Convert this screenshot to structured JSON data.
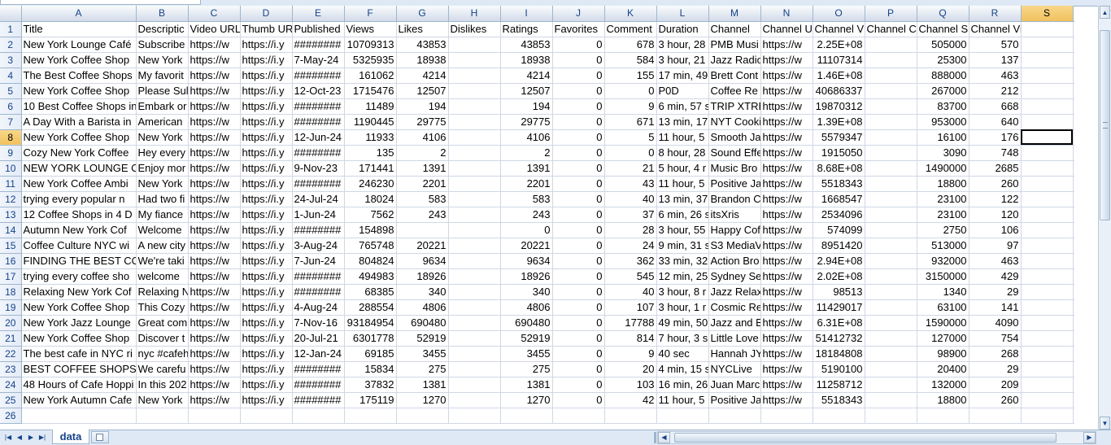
{
  "columns": [
    "A",
    "B",
    "C",
    "D",
    "E",
    "F",
    "G",
    "H",
    "I",
    "J",
    "K",
    "L",
    "M",
    "N",
    "O",
    "P",
    "Q",
    "R",
    "S"
  ],
  "active_cell": {
    "row": 8,
    "col": "S"
  },
  "rows": [
    {
      "num": "1",
      "cells": [
        "Title",
        "Descriptic",
        "Video URL",
        "Thumb UR",
        "Published",
        "Views",
        "Likes",
        "Dislikes",
        "Ratings",
        "Favorites",
        "Comment",
        "Duration",
        "Channel",
        "Channel U",
        "Channel V",
        "Channel C",
        "Channel S",
        "Channel Videos",
        ""
      ]
    },
    {
      "num": "2",
      "cells": [
        "New York Lounge Café",
        "Subscribe",
        "https://w",
        "https://i.y",
        "########",
        "10709313",
        "43853",
        "",
        "43853",
        "0",
        "678",
        "3 hour, 28",
        "PMB Musi",
        "https://w",
        "2.25E+08",
        "",
        "505000",
        "570",
        ""
      ]
    },
    {
      "num": "3",
      "cells": [
        "New York Coffee Shop",
        "New York",
        "https://w",
        "https://i.y",
        "7-May-24",
        "5325935",
        "18938",
        "",
        "18938",
        "0",
        "584",
        "3 hour, 21",
        "Jazz Radio",
        "https://w",
        "11107314",
        "",
        "25300",
        "137",
        ""
      ]
    },
    {
      "num": "4",
      "cells": [
        "The Best Coffee Shops",
        "My favorit",
        "https://w",
        "https://i.y",
        "########",
        "161062",
        "4214",
        "",
        "4214",
        "0",
        "155",
        "17 min, 49",
        "Brett Cont",
        "https://w",
        "1.46E+08",
        "",
        "888000",
        "463",
        ""
      ]
    },
    {
      "num": "5",
      "cells": [
        "New York Coffee Shop",
        "Please Sul",
        "https://w",
        "https://i.y",
        "12-Oct-23",
        "1715476",
        "12507",
        "",
        "12507",
        "0",
        "0",
        "P0D",
        "Coffee Re",
        "https://w",
        "40686337",
        "",
        "267000",
        "212",
        ""
      ]
    },
    {
      "num": "6",
      "cells": [
        "10 Best Coffee Shops in",
        "Embark or",
        "https://w",
        "https://i.y",
        "########",
        "11489",
        "194",
        "",
        "194",
        "0",
        "9",
        "6 min, 57 s",
        "TRIP XTRE",
        "https://w",
        "19870312",
        "",
        "83700",
        "668",
        ""
      ]
    },
    {
      "num": "7",
      "cells": [
        "A Day With a Barista in",
        "American",
        "https://w",
        "https://i.y",
        "########",
        "1190445",
        "29775",
        "",
        "29775",
        "0",
        "671",
        "13 min, 17",
        "NYT Cooki",
        "https://w",
        "1.39E+08",
        "",
        "953000",
        "640",
        ""
      ]
    },
    {
      "num": "8",
      "cells": [
        "New York Coffee Shop",
        "New York",
        "https://w",
        "https://i.y",
        "12-Jun-24",
        "11933",
        "4106",
        "",
        "4106",
        "0",
        "5",
        "11 hour, 5",
        "Smooth Ja",
        "https://w",
        "5579347",
        "",
        "16100",
        "176",
        ""
      ]
    },
    {
      "num": "9",
      "cells": [
        "Cozy New York Coffee",
        "Hey every",
        "https://w",
        "https://i.y",
        "########",
        "135",
        "2",
        "",
        "2",
        "0",
        "0",
        "8 hour, 28",
        "Sound Effe",
        "https://w",
        "1915050",
        "",
        "3090",
        "748",
        ""
      ]
    },
    {
      "num": "10",
      "cells": [
        "NEW YORK LOUNGE CA",
        "Enjoy mor",
        "https://w",
        "https://i.y",
        "9-Nov-23",
        "171441",
        "1391",
        "",
        "1391",
        "0",
        "21",
        "5 hour, 4 r",
        "Music Bro",
        "https://w",
        "8.68E+08",
        "",
        "1490000",
        "2685",
        ""
      ]
    },
    {
      "num": "11",
      "cells": [
        "New York Coffee Ambi",
        "New York",
        "https://w",
        "https://i.y",
        "########",
        "246230",
        "2201",
        "",
        "2201",
        "0",
        "43",
        "11 hour, 5",
        "Positive Ja",
        "https://w",
        "5518343",
        "",
        "18800",
        "260",
        ""
      ]
    },
    {
      "num": "12",
      "cells": [
        "trying every popular n",
        "Had two fi",
        "https://w",
        "https://i.y",
        "24-Jul-24",
        "18024",
        "583",
        "",
        "583",
        "0",
        "40",
        "13 min, 37",
        "Brandon C",
        "https://w",
        "1668547",
        "",
        "23100",
        "122",
        ""
      ]
    },
    {
      "num": "13",
      "cells": [
        "12 Coffee Shops in 4 D",
        "My fiance",
        "https://w",
        "https://i.y",
        "1-Jun-24",
        "7562",
        "243",
        "",
        "243",
        "0",
        "37",
        "6 min, 26 s",
        "itsXris",
        "https://w",
        "2534096",
        "",
        "23100",
        "120",
        ""
      ]
    },
    {
      "num": "14",
      "cells": [
        "Autumn New York Cof",
        "Welcome",
        "https://w",
        "https://i.y",
        "########",
        "154898",
        "",
        "",
        "0",
        "0",
        "28",
        "3 hour, 55",
        "Happy Cof",
        "https://w",
        "574099",
        "",
        "2750",
        "106",
        ""
      ]
    },
    {
      "num": "15",
      "cells": [
        "Coffee Culture NYC wi",
        "A new city",
        "https://w",
        "https://i.y",
        "3-Aug-24",
        "765748",
        "20221",
        "",
        "20221",
        "0",
        "24",
        "9 min, 31 s",
        "S3 MediaV",
        "https://w",
        "8951420",
        "",
        "513000",
        "97",
        ""
      ]
    },
    {
      "num": "16",
      "cells": [
        "FINDING THE BEST COF",
        "We're taki",
        "https://w",
        "https://i.y",
        "7-Jun-24",
        "804824",
        "9634",
        "",
        "9634",
        "0",
        "362",
        "33 min, 32",
        "Action Bro",
        "https://w",
        "2.94E+08",
        "",
        "932000",
        "463",
        ""
      ]
    },
    {
      "num": "17",
      "cells": [
        "trying every coffee sho",
        "welcome",
        "https://w",
        "https://i.y",
        "########",
        "494983",
        "18926",
        "",
        "18926",
        "0",
        "545",
        "12 min, 25",
        "Sydney Se",
        "https://w",
        "2.02E+08",
        "",
        "3150000",
        "429",
        ""
      ]
    },
    {
      "num": "18",
      "cells": [
        "Relaxing New York Cof",
        "Relaxing N",
        "https://w",
        "https://i.y",
        "########",
        "68385",
        "340",
        "",
        "340",
        "0",
        "40",
        "3 hour, 8 r",
        "Jazz Relax",
        "https://w",
        "98513",
        "",
        "1340",
        "29",
        ""
      ]
    },
    {
      "num": "19",
      "cells": [
        "New York Coffee Shop",
        "This Cozy",
        "https://w",
        "https://i.y",
        "4-Aug-24",
        "288554",
        "4806",
        "",
        "4806",
        "0",
        "107",
        "3 hour, 1 r",
        "Cosmic Re",
        "https://w",
        "11429017",
        "",
        "63100",
        "141",
        ""
      ]
    },
    {
      "num": "20",
      "cells": [
        "New York Jazz Lounge",
        "Great com",
        "https://w",
        "https://i.y",
        "7-Nov-16",
        "93184954",
        "690480",
        "",
        "690480",
        "0",
        "17788",
        "49 min, 50",
        "Jazz and B",
        "https://w",
        "6.31E+08",
        "",
        "1590000",
        "4090",
        ""
      ]
    },
    {
      "num": "21",
      "cells": [
        "New York Coffee Shop",
        "Discover t",
        "https://w",
        "https://i.y",
        "20-Jul-21",
        "6301778",
        "52919",
        "",
        "52919",
        "0",
        "814",
        "7 hour, 3 s",
        "Little Love",
        "https://w",
        "51412732",
        "",
        "127000",
        "754",
        ""
      ]
    },
    {
      "num": "22",
      "cells": [
        "The best cafe in NYC ri",
        "nyc #cafeh",
        "https://w",
        "https://i.y",
        "12-Jan-24",
        "69185",
        "3455",
        "",
        "3455",
        "0",
        "9",
        "40 sec",
        "Hannah JY",
        "https://w",
        "18184808",
        "",
        "98900",
        "268",
        ""
      ]
    },
    {
      "num": "23",
      "cells": [
        "BEST COFFEE SHOPS in",
        "We carefu",
        "https://w",
        "https://i.y",
        "########",
        "15834",
        "275",
        "",
        "275",
        "0",
        "20",
        "4 min, 15 s",
        "NYCLive",
        "https://w",
        "5190100",
        "",
        "20400",
        "29",
        ""
      ]
    },
    {
      "num": "24",
      "cells": [
        "48 Hours of Cafe Hoppi",
        "In this 202",
        "https://w",
        "https://i.y",
        "########",
        "37832",
        "1381",
        "",
        "1381",
        "0",
        "103",
        "16 min, 26",
        "Juan Marc",
        "https://w",
        "11258712",
        "",
        "132000",
        "209",
        ""
      ]
    },
    {
      "num": "25",
      "cells": [
        "New York Autumn Cafe",
        "New York",
        "https://w",
        "https://i.y",
        "########",
        "175119",
        "1270",
        "",
        "1270",
        "0",
        "42",
        "11 hour, 5",
        "Positive Ja",
        "https://w",
        "5518343",
        "",
        "18800",
        "260",
        ""
      ]
    },
    {
      "num": "26",
      "cells": [
        "",
        "",
        "",
        "",
        "",
        "",
        "",
        "",
        "",
        "",
        "",
        "",
        "",
        "",
        "",
        "",
        "",
        "",
        ""
      ]
    }
  ],
  "sheet_tab": {
    "label": "data"
  },
  "nav_icons": [
    "first-sheet-icon",
    "prev-sheet-icon",
    "next-sheet-icon",
    "last-sheet-icon"
  ]
}
